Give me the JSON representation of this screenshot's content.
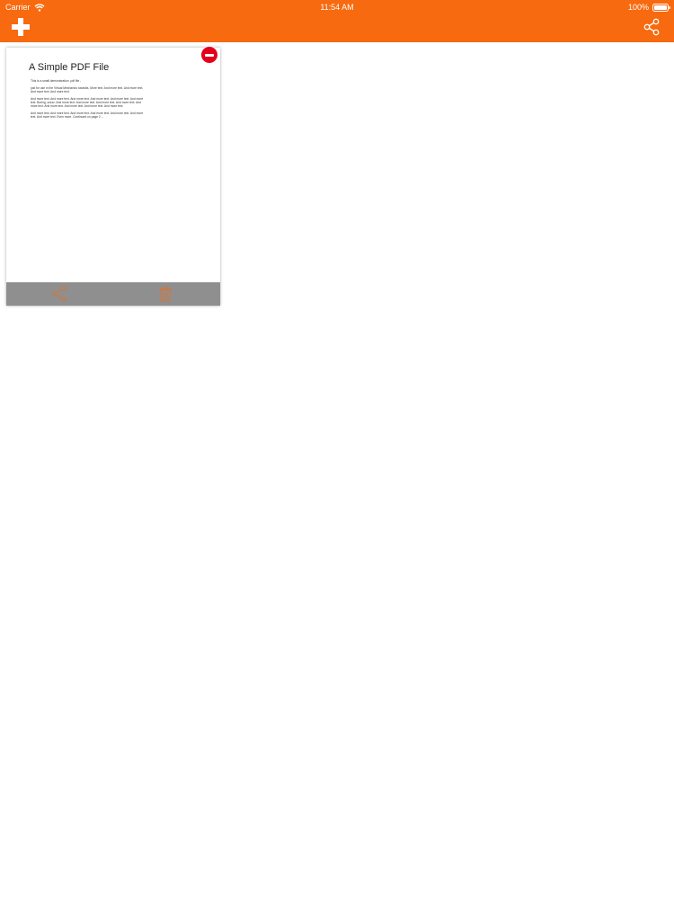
{
  "status_bar": {
    "carrier": "Carrier",
    "time": "11:54 AM",
    "battery": "100%"
  },
  "colors": {
    "brand": "#f76a0f",
    "delete": "#e2001e",
    "footer": "#8f8f8f"
  },
  "icons": {
    "add": "plus-icon",
    "share": "share-icon",
    "trash": "trash-icon",
    "delete": "minus-circle-icon"
  },
  "document": {
    "title": "A Simple PDF File",
    "paragraphs": [
      "This is a small demonstration .pdf file -",
      "just for use in the Virtual Mechanics tutorials. More text. And more text. And more text. And more text. And more text.",
      "And more text. And more text. And more text. And more text. And more text. And more text. Boring, zzzzz. And more text. And more text. And more text. And more text. And more text. And more text. And more text. And more text. And more text.",
      "And more text. And more text. And more text. And more text. And more text. And more text. And more text. Even more. Continued on page 2 ..."
    ]
  }
}
